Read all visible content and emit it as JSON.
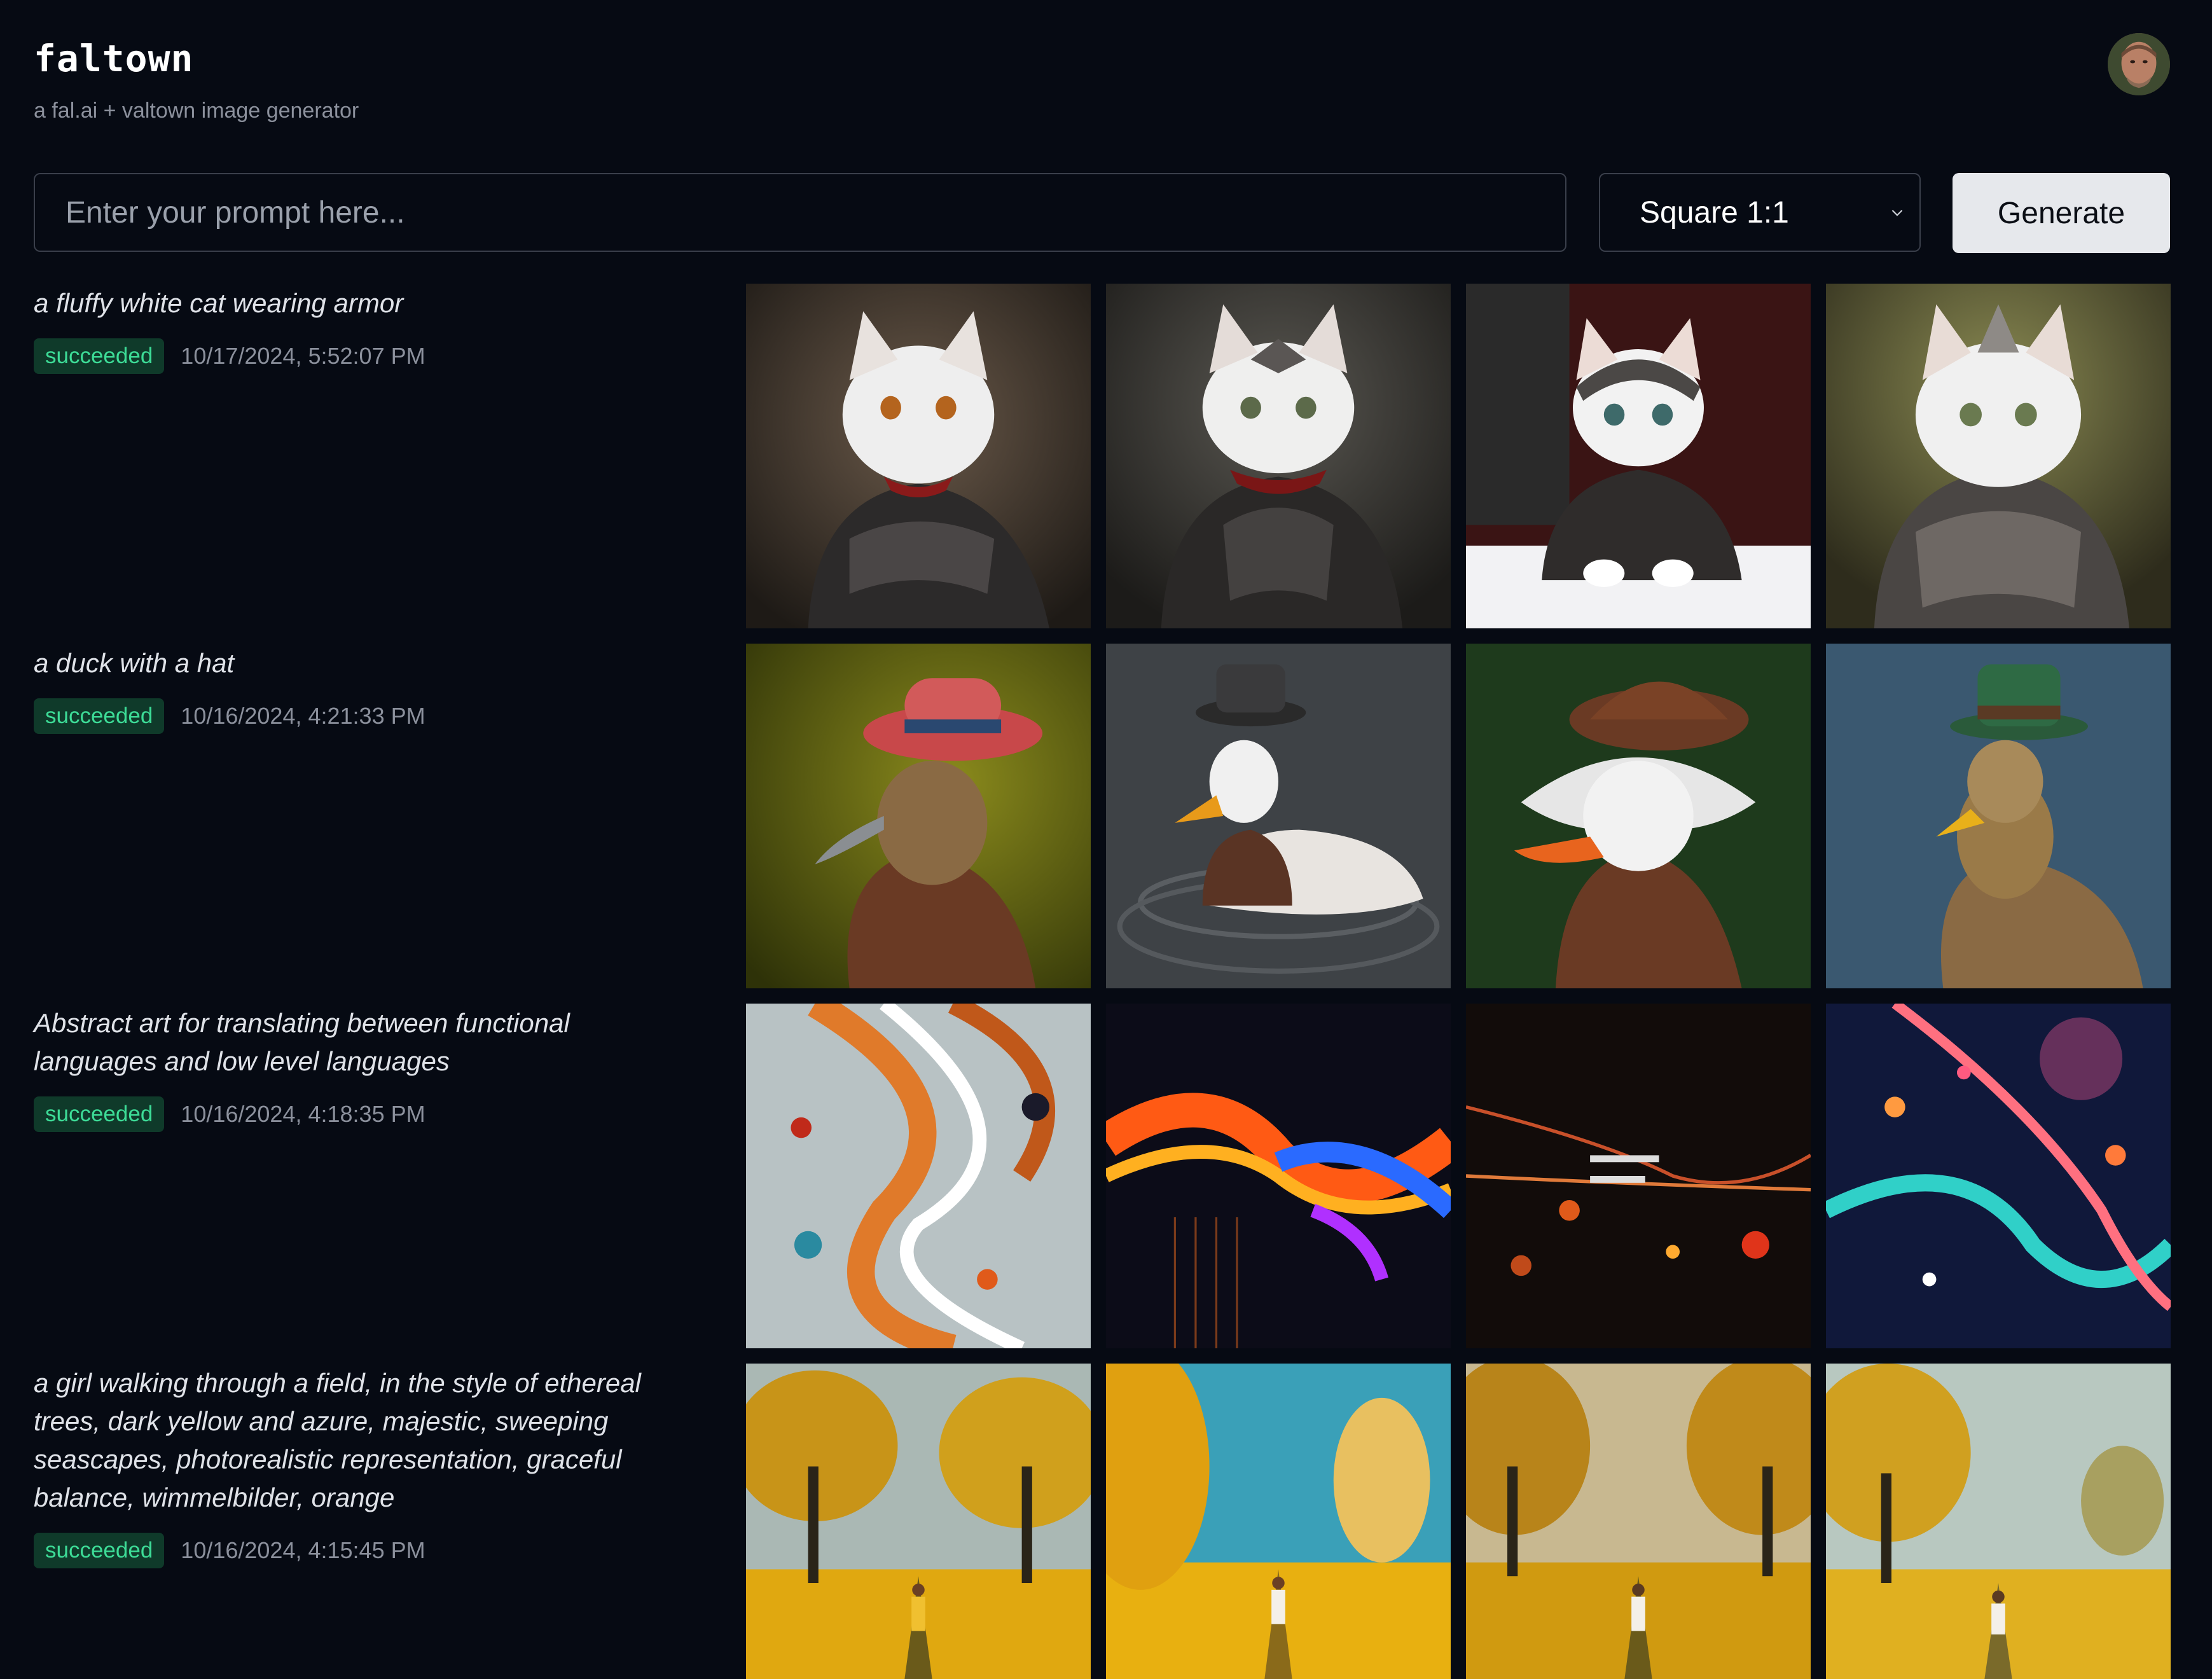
{
  "app": {
    "title": "faltown",
    "subtitle": "a fal.ai + valtown image generator"
  },
  "form": {
    "prompt_placeholder": "Enter your prompt here...",
    "prompt_value": "",
    "aspect_selected": "Square 1:1",
    "generate_label": "Generate"
  },
  "jobs": [
    {
      "prompt": "a fluffy white cat wearing armor",
      "status": "succeeded",
      "timestamp": "10/17/2024, 5:52:07 PM",
      "images": [
        "armored-white-cat-1",
        "armored-white-cat-2",
        "armored-white-cat-3",
        "armored-white-cat-4"
      ]
    },
    {
      "prompt": "a duck with a hat",
      "status": "succeeded",
      "timestamp": "10/16/2024, 4:21:33 PM",
      "images": [
        "duck-red-hat",
        "duck-top-hat-water",
        "duck-brown-cap",
        "duck-green-top-hat"
      ]
    },
    {
      "prompt": "Abstract art for translating between functional languages and low level languages",
      "status": "succeeded",
      "timestamp": "10/16/2024, 4:18:35 PM",
      "images": [
        "abstract-swirl-light",
        "abstract-fire-code",
        "abstract-dark-code-particles",
        "abstract-neon-waves"
      ]
    },
    {
      "prompt": "a girl walking through a field, in the style of ethereal trees, dark yellow and azure, majestic, sweeping seascapes, photorealistic representation, graceful balance, wimmelbilder, orange",
      "status": "succeeded",
      "timestamp": "10/16/2024, 4:15:45 PM",
      "images": [
        "girl-yellow-field-1",
        "girl-yellow-field-2",
        "girl-yellow-field-3",
        "girl-yellow-field-4"
      ]
    }
  ],
  "colors": {
    "background": "#060a13",
    "status_success_bg": "#0f3a2a",
    "status_success_text": "#3ddc97",
    "button_bg": "#e6e8ec"
  }
}
